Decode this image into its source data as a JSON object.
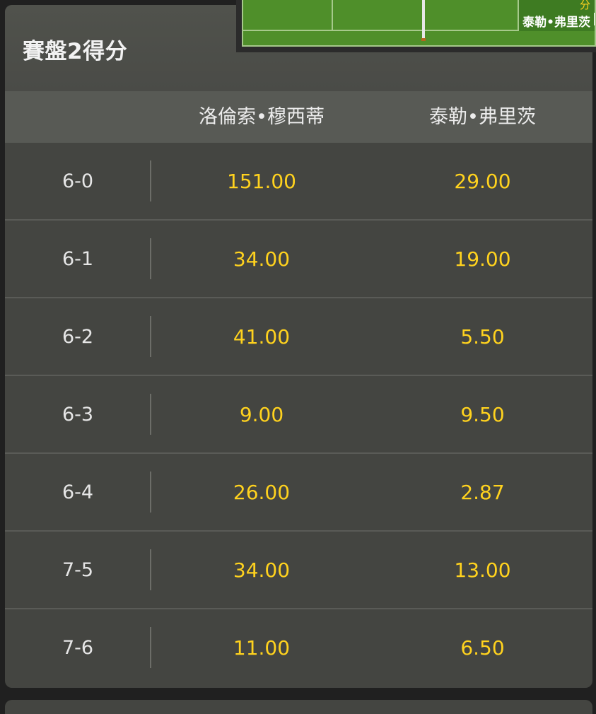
{
  "panel": {
    "title": "賽盤2得分",
    "players": [
      "洛倫索•穆西蒂",
      "泰勒•弗里茨"
    ]
  },
  "rows": [
    {
      "score": "6-0",
      "p1": "151.00",
      "p2": "29.00"
    },
    {
      "score": "6-1",
      "p1": "34.00",
      "p2": "19.00"
    },
    {
      "score": "6-2",
      "p1": "41.00",
      "p2": "5.50"
    },
    {
      "score": "6-3",
      "p1": "9.00",
      "p2": "9.50"
    },
    {
      "score": "6-4",
      "p1": "26.00",
      "p2": "2.87"
    },
    {
      "score": "7-5",
      "p1": "34.00",
      "p2": "13.00"
    },
    {
      "score": "7-6",
      "p1": "11.00",
      "p2": "6.50"
    }
  ],
  "court_widget": {
    "label": "分",
    "player": "泰勒•弗里茨"
  },
  "colors": {
    "odds": "#ffd21e",
    "panel_bg": "#444541",
    "court": "#4f8f2a"
  }
}
